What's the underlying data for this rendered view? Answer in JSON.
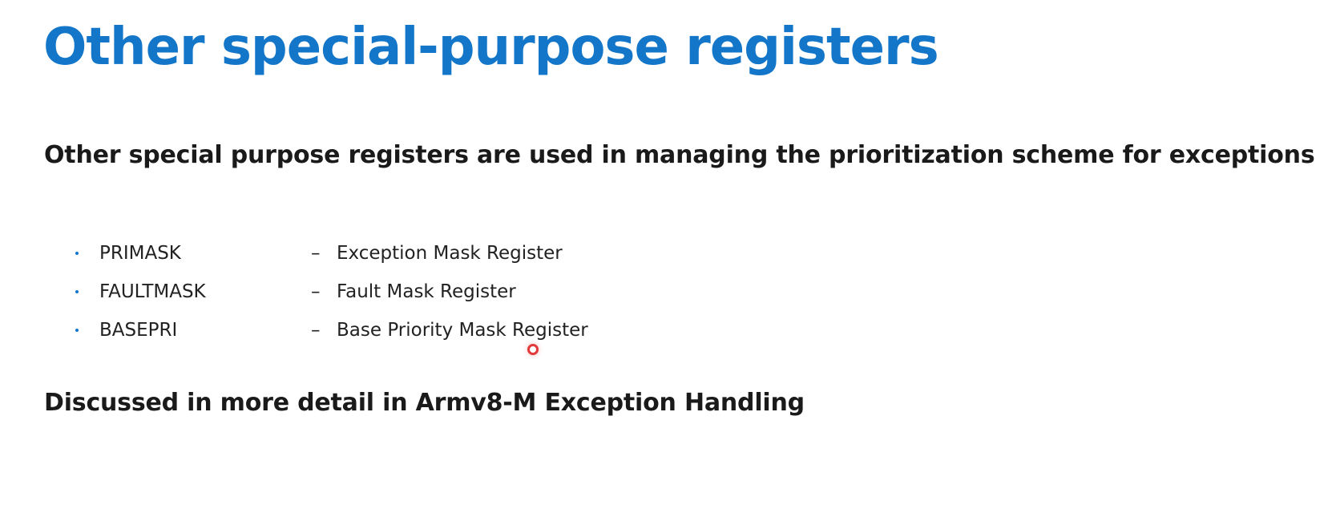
{
  "slide": {
    "title": "Other special-purpose registers",
    "subtitle": "Other special purpose registers are used in managing the prioritization scheme for exceptions",
    "registers": [
      {
        "name": "PRIMASK",
        "dash": "–",
        "description": "Exception Mask Register"
      },
      {
        "name": "FAULTMASK",
        "dash": "–",
        "description": "Fault Mask Register"
      },
      {
        "name": "BASEPRI",
        "dash": "–",
        "description": "Base Priority Mask Register"
      }
    ],
    "footer_note": "Discussed in more detail in Armv8-M Exception Handling"
  },
  "colors": {
    "title": "#1376c8",
    "text": "#1a1a1a",
    "bullet": "#1376c8",
    "pointer": "#e23a3a"
  }
}
